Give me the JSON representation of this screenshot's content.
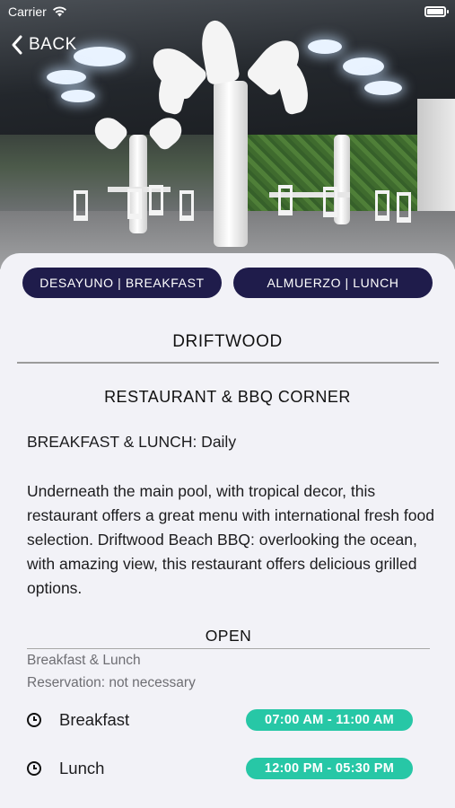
{
  "status_bar": {
    "carrier": "Carrier"
  },
  "nav": {
    "back_label": "BACK"
  },
  "tabs": [
    {
      "label": "DESAYUNO | BREAKFAST"
    },
    {
      "label": "ALMUERZO | LUNCH"
    }
  ],
  "restaurant": {
    "name": "DRIFTWOOD",
    "subtitle": "RESTAURANT & BBQ CORNER",
    "hours": "BREAKFAST & LUNCH: Daily",
    "description": "Underneath the main pool, with tropical decor, this restaurant offers a great menu with international fresh food selection. Driftwood Beach BBQ: overlooking the ocean, with amazing view, this restaurant offers delicious grilled options."
  },
  "schedule": {
    "status": "OPEN",
    "meals_info": "Breakfast & Lunch",
    "reservation": "Reservation: not necessary",
    "items": [
      {
        "meal": "Breakfast",
        "time": "07:00 AM - 11:00 AM"
      },
      {
        "meal": "Lunch",
        "time": "12:00 PM - 05:30 PM"
      }
    ]
  },
  "colors": {
    "tab_background": "#1f1c4b",
    "time_badge": "#27c7a6",
    "background": "#f2f2f7"
  }
}
